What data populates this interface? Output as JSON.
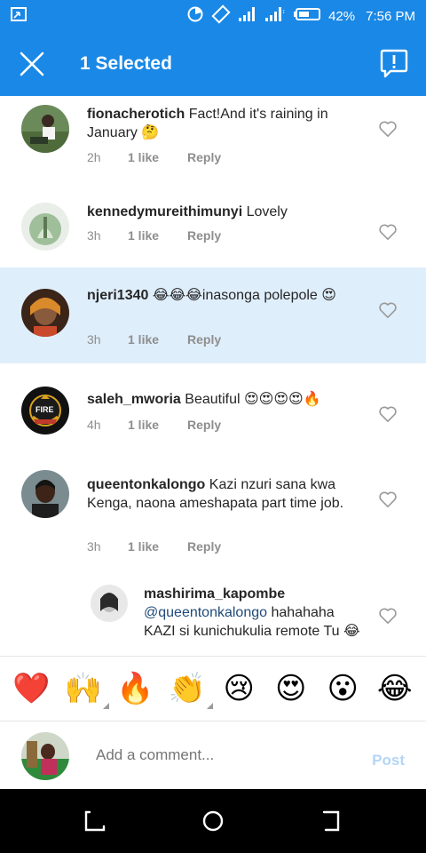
{
  "status_bar": {
    "battery": "42%",
    "time": "7:56 PM",
    "icons": [
      "screenshot-icon",
      "data-saver-icon",
      "rotate-icon",
      "signal-icon",
      "signal-2-icon",
      "battery-icon"
    ]
  },
  "header": {
    "title": "1 Selected",
    "close_icon": "close-icon",
    "report_icon": "report-icon"
  },
  "comments": [
    {
      "username": "fionacherotich",
      "text": "Fact!And it's raining in January 🤔",
      "age": "2h",
      "likes": "1 like",
      "reply": "Reply",
      "selected": false
    },
    {
      "username": "kennedymureithimunyi",
      "text": "Lovely",
      "age": "3h",
      "likes": "1 like",
      "reply": "Reply",
      "selected": false
    },
    {
      "username": "njeri1340",
      "text": "😂😂😂inasonga polepole 😍",
      "age": "3h",
      "likes": "1 like",
      "reply": "Reply",
      "selected": true
    },
    {
      "username": "saleh_mworia",
      "text": "Beautiful 😍😍😍😍🔥",
      "age": "4h",
      "likes": "1 like",
      "reply": "Reply",
      "selected": false
    },
    {
      "username": "queentonkalongo",
      "text": "Kazi nzuri sana kwa Kenga, naona ameshapata part time job.",
      "age": "3h",
      "likes": "1 like",
      "reply": "Reply",
      "selected": false
    }
  ],
  "reply_comment": {
    "username": "mashirima_kapombe",
    "mention": "@queentonkalongo",
    "text": " hahahaha KAZI si kunichukulia remote Tu 😂"
  },
  "avatar_badge": "FIRE",
  "reactions": [
    "❤️",
    "🙌",
    "🔥",
    "👏",
    "😢",
    "😍",
    "😮",
    "😂"
  ],
  "composer": {
    "placeholder": "Add a comment...",
    "post_label": "Post"
  },
  "colors": {
    "accent": "#1a88e6",
    "selected_row": "#dfeefb",
    "meta_text": "#8e8e8e",
    "post_disabled": "#b3d5f7"
  }
}
